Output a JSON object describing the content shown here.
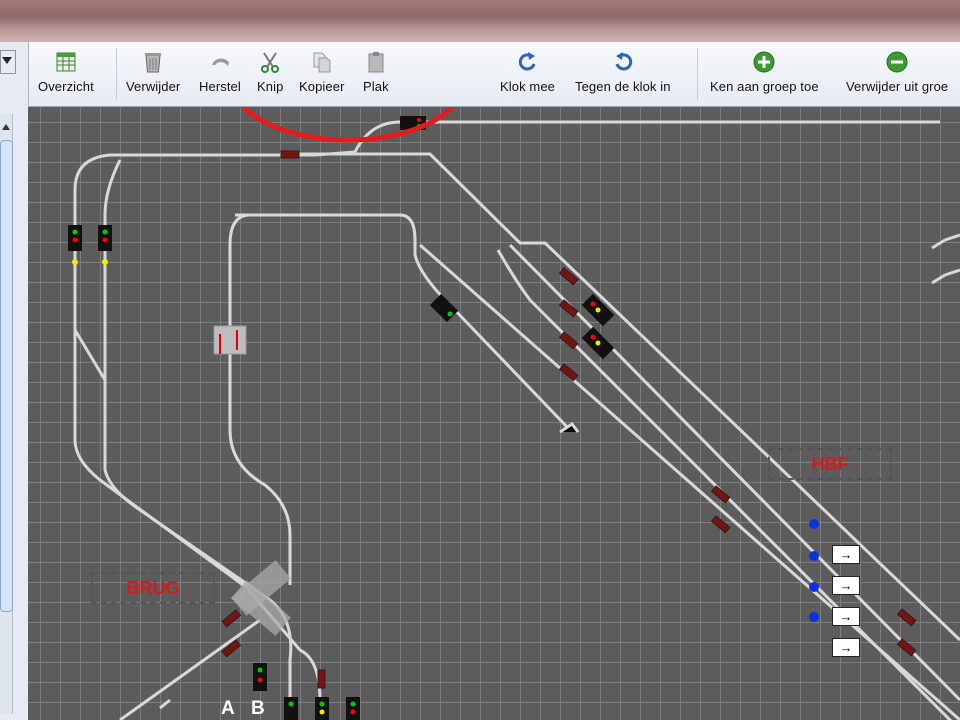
{
  "toolbar": {
    "buttons": [
      {
        "label": "Overzicht",
        "icon": "grid-icon"
      },
      {
        "label": "Verwijder",
        "icon": "trash-icon"
      },
      {
        "label": "Herstel",
        "icon": "undo-icon"
      },
      {
        "label": "Knip",
        "icon": "scissors-icon"
      },
      {
        "label": "Kopieer",
        "icon": "copy-icon"
      },
      {
        "label": "Plak",
        "icon": "paste-icon"
      },
      {
        "label": "Klok mee",
        "icon": "rotate-clockwise-icon"
      },
      {
        "label": "Tegen de klok in",
        "icon": "rotate-counterclockwise-icon"
      },
      {
        "label": "Ken aan groep toe",
        "icon": "add-group-icon"
      },
      {
        "label": "Verwijder uit groe",
        "icon": "remove-group-icon"
      }
    ]
  },
  "layout": {
    "zones": [
      {
        "label": "HBF"
      },
      {
        "label": "BRUG"
      }
    ],
    "track_labels": [
      "A",
      "B"
    ],
    "direction_arrow": "→"
  },
  "colors": {
    "annotation_circle": "#e31d1d",
    "zone_text": "#d41a1a",
    "track": "#d9d9d9",
    "sensor_block": "#7a1212",
    "sensor_dot": "#1030e0",
    "canvas_bg": "#5c5c5c",
    "grid": "#7d7d7d"
  }
}
